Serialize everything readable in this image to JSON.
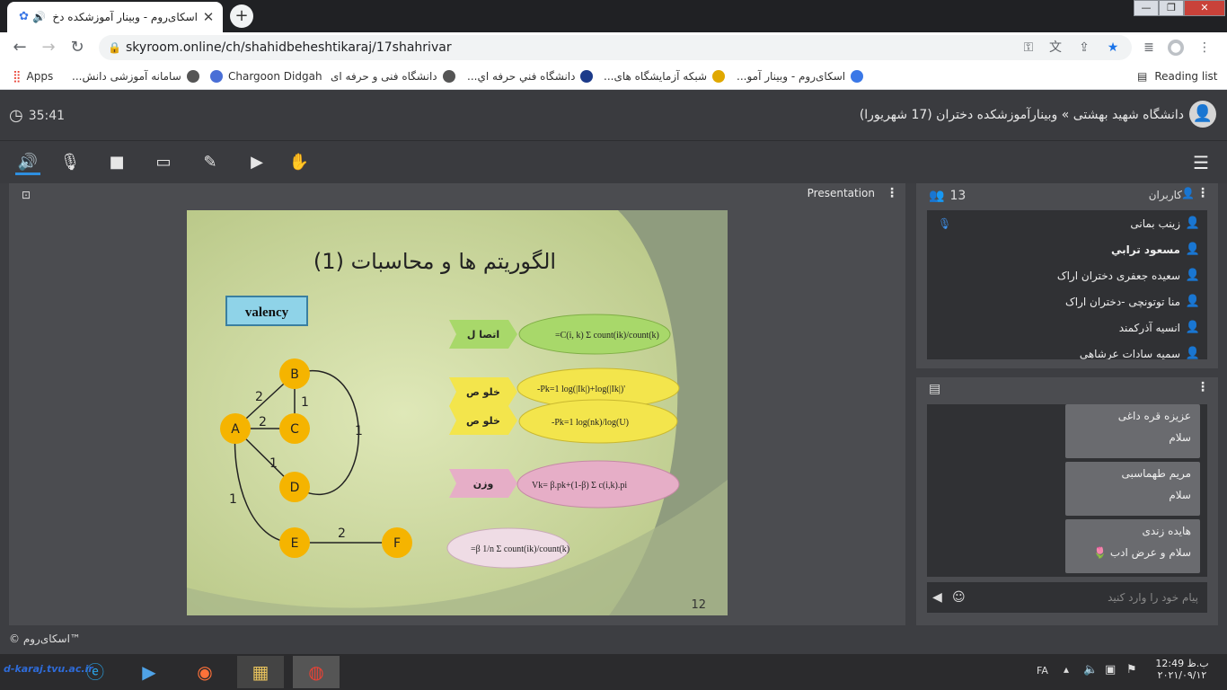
{
  "browser": {
    "tab_title": "اسکای‌روم - وبینار آموزشکده دخ",
    "url": "skyroom.online/ch/shahidbeheshtikaraj/17shahrivar",
    "bookmarks": [
      "Apps",
      "سامانه آموزشی دانش...",
      "Chargoon Didgah",
      "دانشگاه فنی و حرفه ای",
      "دانشگاه فني حرفه اي...",
      "شبکه آزمایشگاه های...",
      "اسکای‌روم - وبینار آمو..."
    ],
    "reading_list": "Reading list"
  },
  "app": {
    "timer": "35:41",
    "room_title": "دانشگاه شهید بهشتی » وبینارآموزشکده دختران (17 شهریورا)",
    "presentation_label": "Presentation",
    "footer": "© اسکای‌روم™"
  },
  "slide": {
    "title": "الگوریتم ها و محاسبات (1)",
    "valency": "valency",
    "page": "12",
    "arrow_connect": "اتصا ل",
    "arrow_closeness1": "خلو ص",
    "arrow_closeness2": "خلو ص",
    "arrow_weight": "وزن",
    "nodes": [
      "A",
      "B",
      "C",
      "D",
      "E",
      "F"
    ],
    "edge_labels": [
      "2",
      "1",
      "2",
      "1",
      "1",
      "1",
      "2"
    ]
  },
  "users": {
    "title": "کاربران",
    "count": "13",
    "list": [
      {
        "name": "زینب بمانی",
        "color": "#3d8ee6"
      },
      {
        "name": "مسعود ترابي",
        "color": "#3d8ee6"
      },
      {
        "name": "سعیده جعفری دختران اراک",
        "color": "#f2c94c"
      },
      {
        "name": "منا توتونچی -دختران اراک",
        "color": "#f2c94c"
      },
      {
        "name": "انسیه آذرکمند",
        "color": "#f2c94c"
      },
      {
        "name": "سمیه سادات عرشاهی",
        "color": "#f2c94c"
      }
    ]
  },
  "chat": {
    "messages": [
      {
        "name": "عزیزه قره داغی",
        "text": "سلام"
      },
      {
        "name": "مریم طهماسبی",
        "text": "سلام"
      },
      {
        "name": "هایده زندی",
        "text": "سلام و عرض ادب 🌷"
      }
    ],
    "placeholder": "پیام خود را وارد کنید"
  },
  "taskbar": {
    "lang": "FA",
    "time": "12:49 ب.ظ",
    "date": "۲۰۲۱/۰۹/۱۲",
    "logo_text": "d-karaj.tvu.ac.ir"
  }
}
